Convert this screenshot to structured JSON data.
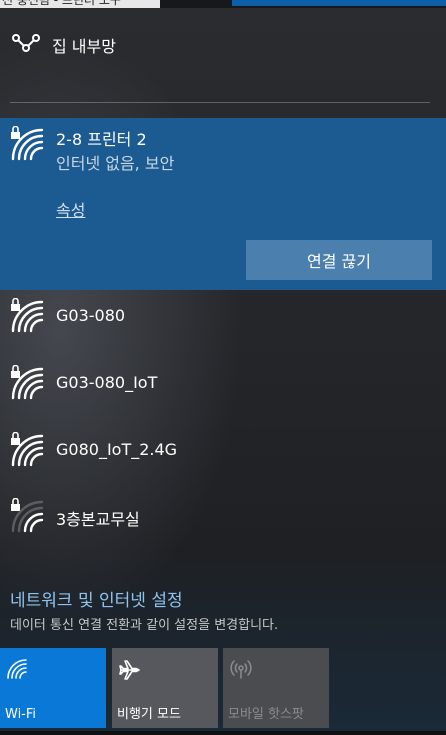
{
  "top_clip_text": "선 충전됨 - 프린터 도구",
  "home_network": {
    "label": "집 내부망",
    "icon": "vpn-dial-icon"
  },
  "active_network": {
    "name": "2-8 프린터 2",
    "status": "인터넷 없음, 보안",
    "properties_link": "속성",
    "disconnect_button": "연결 끊기",
    "icon": "wifi-secured-icon"
  },
  "networks": [
    {
      "name": "G03-080",
      "icon": "wifi-secured-icon"
    },
    {
      "name": "G03-080_IoT",
      "icon": "wifi-secured-icon"
    },
    {
      "name": "G080_IoT_2.4G",
      "icon": "wifi-secured-icon"
    },
    {
      "name": "3층본교무실",
      "icon": "wifi-secured-weak-icon"
    }
  ],
  "settings": {
    "link": "네트워크 및 인터넷 설정",
    "description": "데이터 통신 연결 전환과 같이 설정을 변경합니다."
  },
  "quick_actions": {
    "wifi": {
      "label": "Wi-Fi",
      "state": "on",
      "color": "#0a78d6"
    },
    "airplane": {
      "label": "비행기 모드",
      "state": "off"
    },
    "hotspot": {
      "label": "모바일 핫스팟",
      "state": "disabled"
    }
  },
  "colors": {
    "accent": "#0a78d6",
    "active_row": "#1b5b92",
    "disconnect": "#4a7fae",
    "link": "#8fc3ef"
  }
}
